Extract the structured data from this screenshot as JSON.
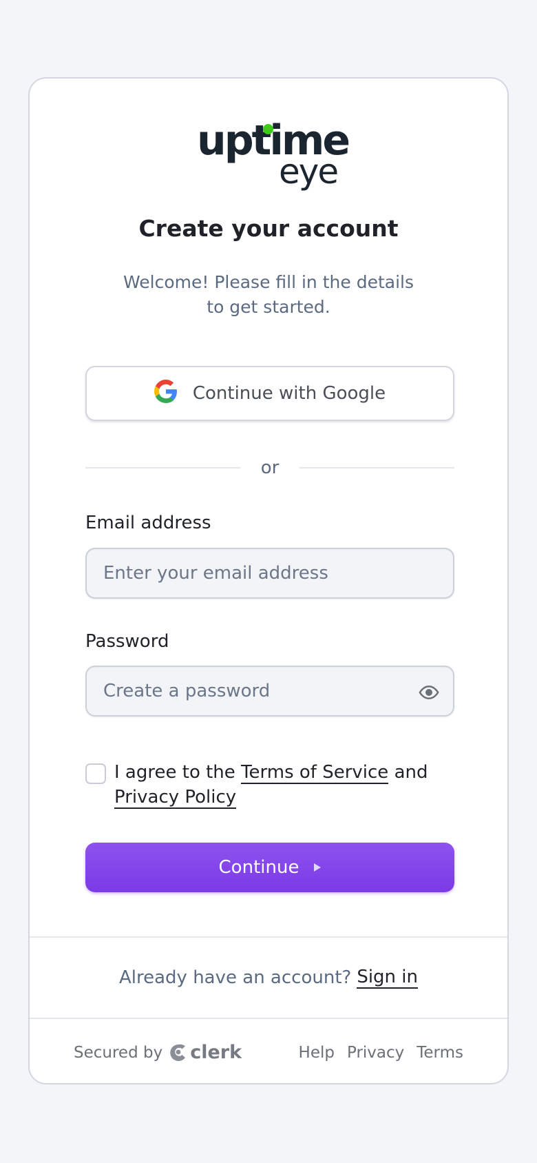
{
  "logo": {
    "top": "uptime",
    "bottom": "eye",
    "dot_color": "#3ecb1b"
  },
  "heading": {
    "title": "Create your account",
    "subtitle": "Welcome! Please fill in the details to get started."
  },
  "social": {
    "google_label": "Continue with Google",
    "icon": "google-icon"
  },
  "divider": {
    "text": "or"
  },
  "email": {
    "label": "Email address",
    "placeholder": "Enter your email address",
    "value": ""
  },
  "password": {
    "label": "Password",
    "placeholder": "Create a password",
    "value": "",
    "toggle_icon": "eye-icon"
  },
  "agree": {
    "prefix": "I agree to the",
    "terms_link": "Terms of Service",
    "middle": "and",
    "privacy_link": "Privacy Policy",
    "checked": false
  },
  "continue": {
    "label": "Continue",
    "color": "#8447eb"
  },
  "signin": {
    "prompt": "Already have an account?",
    "link": "Sign in"
  },
  "footer": {
    "secured_by": "Secured by",
    "brand": "clerk",
    "links": [
      "Help",
      "Privacy",
      "Terms"
    ]
  }
}
